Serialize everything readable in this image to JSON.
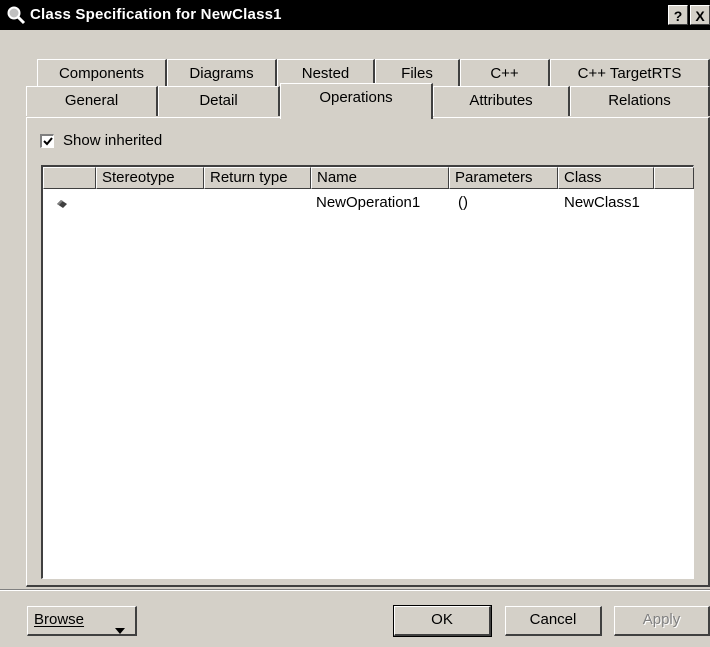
{
  "window": {
    "title": "Class Specification for NewClass1",
    "help_label": "?",
    "close_label": "X"
  },
  "tabs": {
    "row1": [
      "Components",
      "Diagrams",
      "Nested",
      "Files",
      "C++",
      "C++ TargetRTS"
    ],
    "row2": [
      "General",
      "Detail",
      "Operations",
      "Attributes",
      "Relations"
    ],
    "active": "Operations"
  },
  "options": {
    "show_inherited_label": "Show inherited",
    "show_inherited_checked": true
  },
  "table": {
    "columns": [
      "",
      "Stereotype",
      "Return type",
      "Name",
      "Parameters",
      "Class",
      ""
    ],
    "rows": [
      {
        "icon": "operation-icon",
        "stereotype": "",
        "return_type": "",
        "name": "NewOperation1",
        "parameters": "()",
        "class": "NewClass1"
      }
    ]
  },
  "buttons": {
    "browse": "Browse",
    "ok": "OK",
    "cancel": "Cancel",
    "apply": "Apply"
  }
}
